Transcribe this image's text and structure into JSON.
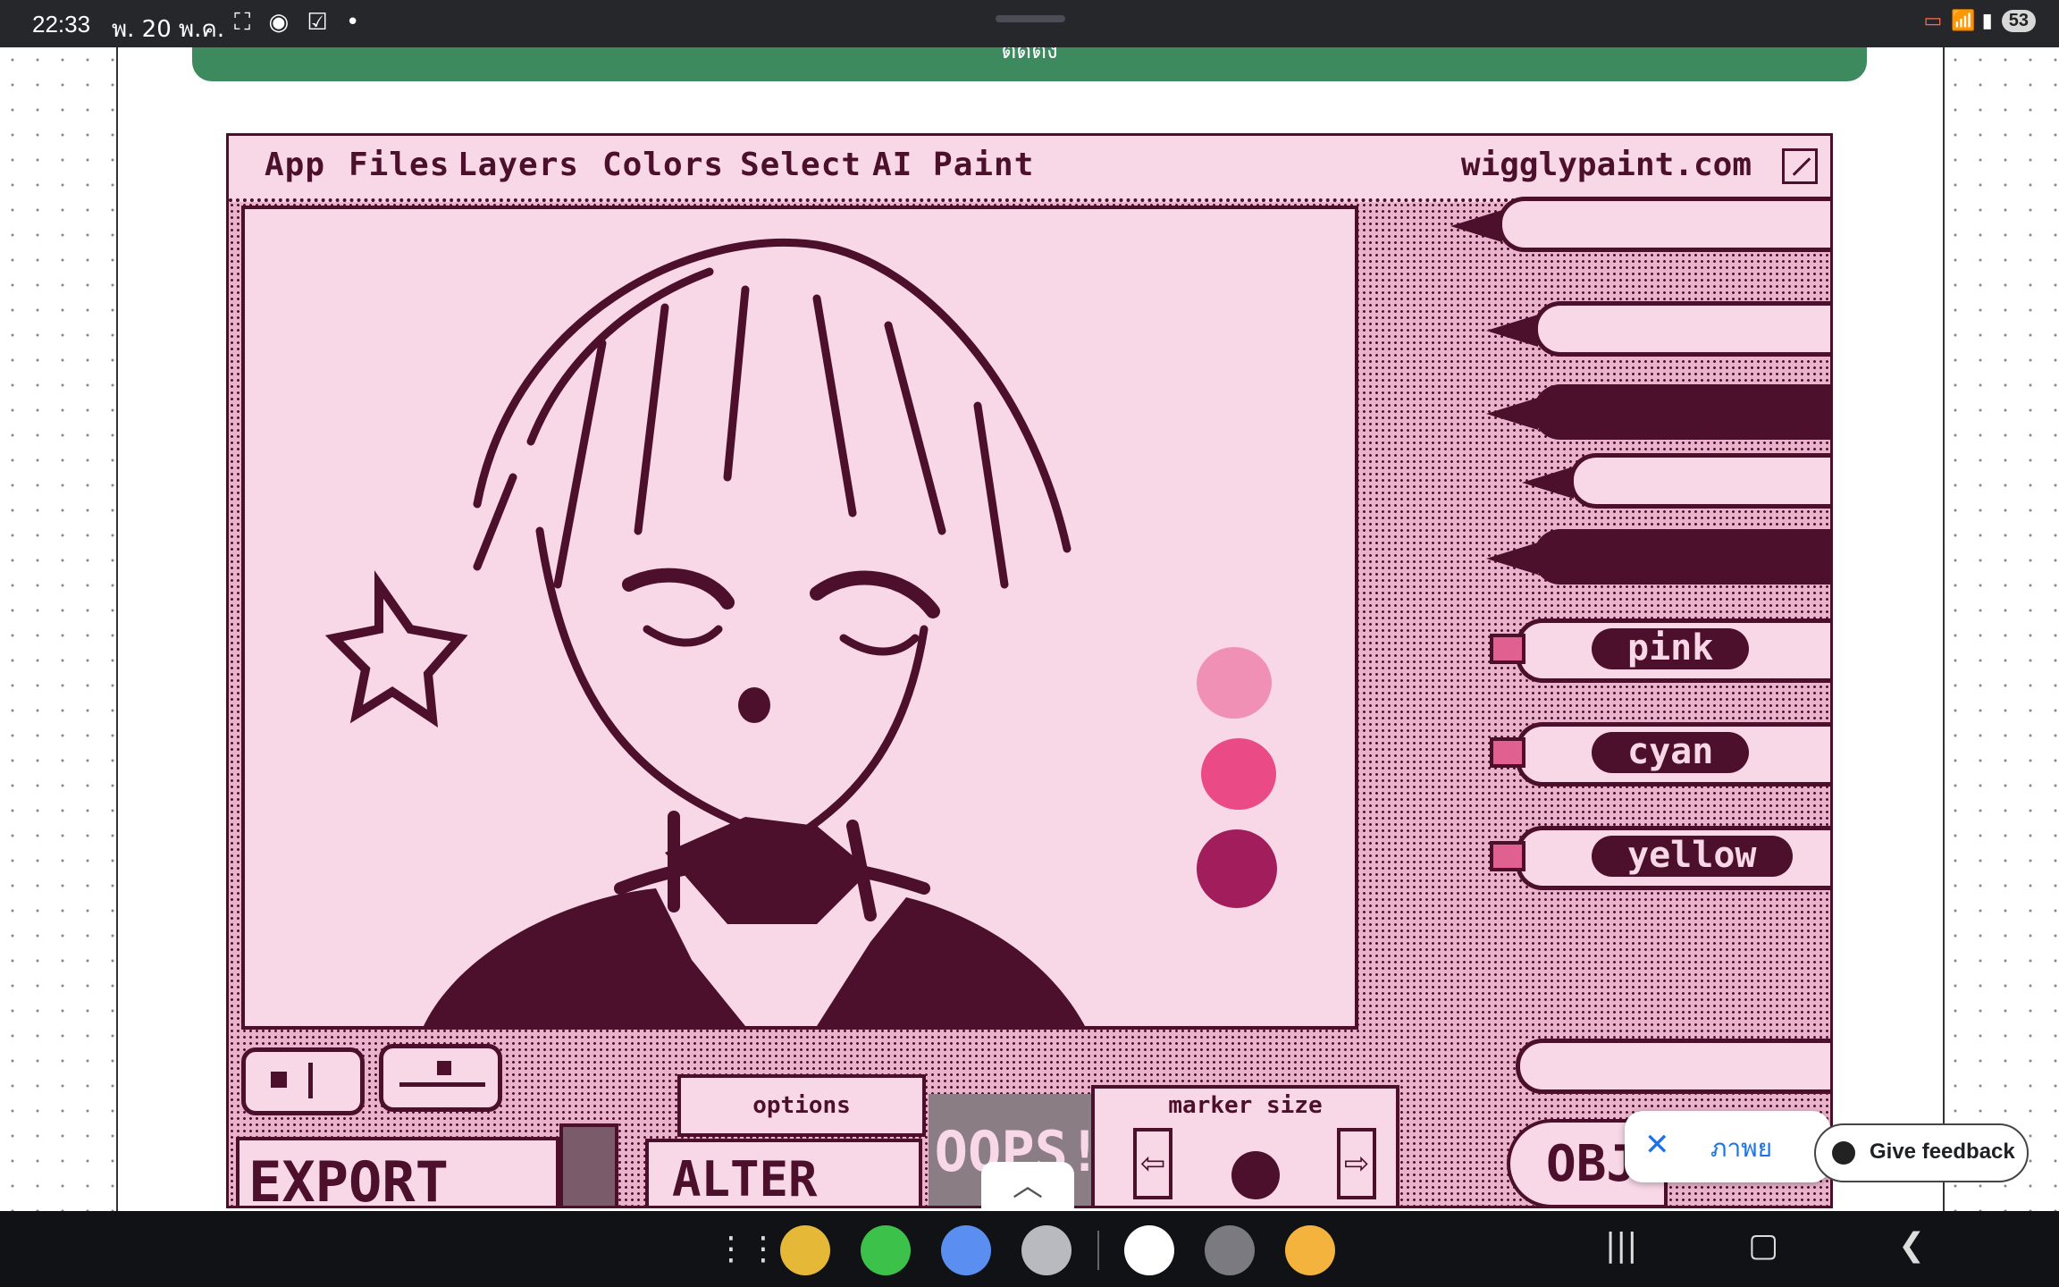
{
  "status_bar": {
    "time": "22:33",
    "date": "พ. 20 พ.ค.",
    "left_icons": "⛶ ◉ ☑ •",
    "battery": "53",
    "right_icons": "📶 ▮"
  },
  "page": {
    "top_button_label": "ติดตั้ง"
  },
  "wigglypaint": {
    "menu": [
      "App",
      "Files",
      "Layers",
      "Colors",
      "Select",
      "AI Paint"
    ],
    "site": "wigglypaint.com",
    "markers": [
      "pink",
      "cyan",
      "yellow"
    ],
    "swatches": [
      "#f090b4",
      "#ea4a86",
      "#a21d5c"
    ],
    "options_label": "options",
    "marker_size_label": "marker size",
    "export_label": "EXPORT",
    "alter_label": "ALTER",
    "oops_label": "OOPS!",
    "obj_label": "OBJ",
    "left_arrow": "⇦",
    "right_arrow": "⇨"
  },
  "overlay": {
    "close": "✕",
    "chip_text": "ภาพย",
    "feedback": "Give feedback"
  },
  "taskbar": {
    "apps": [
      {
        "name": "files",
        "color": "#e5b838"
      },
      {
        "name": "phone",
        "color": "#3cc14a"
      },
      {
        "name": "messages",
        "color": "#5a8ef0"
      },
      {
        "name": "camera",
        "color": "#b9b9c0"
      },
      {
        "name": "google",
        "color": "#ffffff"
      },
      {
        "name": "settings",
        "color": "#7a7a80"
      },
      {
        "name": "photos",
        "color": "#f3b33d"
      }
    ]
  },
  "colors": {
    "ink": "#4c0f2c",
    "paper": "#f8d8e6",
    "green": "#3e8a5f"
  }
}
